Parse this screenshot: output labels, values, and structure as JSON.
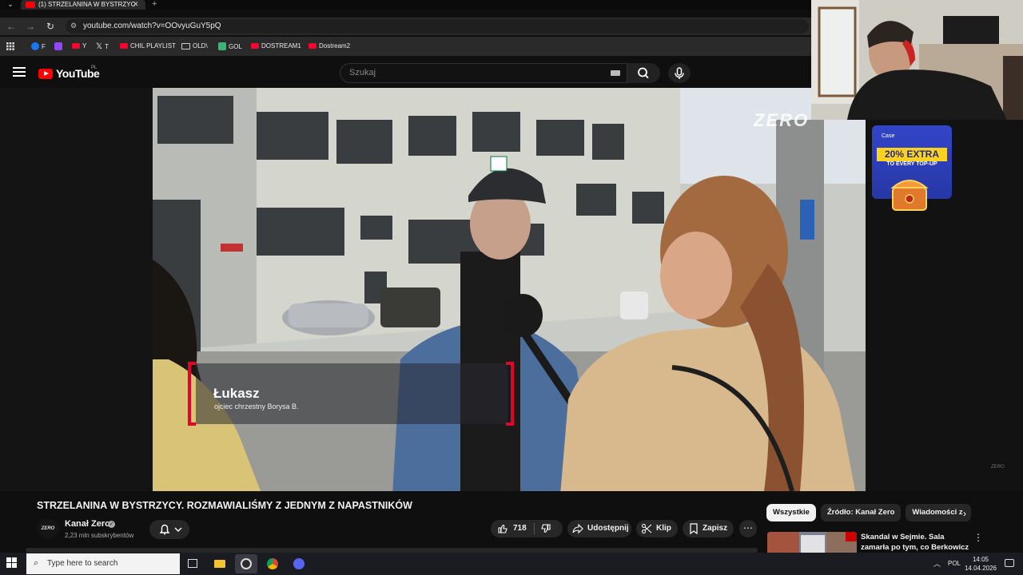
{
  "browser": {
    "tab_title": "(1) STRZELANINA W BYSTRZYC",
    "tab_close": "✕",
    "new_tab": "+",
    "url": "youtube.com/watch?v=OOvyuGuY5pQ",
    "bookmarks": [
      {
        "label": "F",
        "icon": "facebook-icon",
        "color": "#1877f2"
      },
      {
        "label": "",
        "icon": "twitch-icon",
        "color": "#9146ff"
      },
      {
        "label": "Y",
        "icon": "youtube-icon",
        "color": "#ff0033"
      },
      {
        "label": "T",
        "icon": "x-icon",
        "color": "#e7e7e7"
      },
      {
        "label": "CHIL PLAYLIST",
        "icon": "youtube-icon",
        "color": "#ff0033"
      },
      {
        "label": "OLD\\",
        "icon": "folder-icon",
        "color": "#c8c8c8"
      },
      {
        "label": "GOL",
        "icon": "gol-icon",
        "color": "#3bb37a"
      },
      {
        "label": "DOSTREAM1",
        "icon": "youtube-icon",
        "color": "#ff0033"
      },
      {
        "label": "Dostream2",
        "icon": "youtube-icon",
        "color": "#ff0033"
      }
    ]
  },
  "youtube": {
    "logo_text": "YouTube",
    "region": "PL",
    "search_placeholder": "Szukaj",
    "accent": "#ff0000"
  },
  "video": {
    "lower_third_name": "Łukasz",
    "lower_third_role": "ojciec chrzestny Borysa B.",
    "watermark": "ZERO",
    "watermark_small": "ZERO",
    "accent": "#e3002b"
  },
  "ad": {
    "brand": "Case",
    "headline": "20% EXTRA",
    "sub": "TO EVERY TOP-UP"
  },
  "below": {
    "title": "STRZELANINA W BYSTRZYCY. ROZMAWIALIŚMY Z JEDNYM Z NAPASTNIKÓW",
    "channel_avatar": "ZERO",
    "channel_name": "Kanał Zero",
    "subscribers": "2,23 mln subskrybentów",
    "likes": "718",
    "share": "Udostępnij",
    "clip": "Klip",
    "save": "Zapisz",
    "chips": [
      "Wszystkie",
      "Źródło: Kanał Zero",
      "Wiadomości z"
    ],
    "rec_title": "Skandal w Sejmie. Sala zamarła po tym, co Berkowicz wyjął na ..."
  },
  "taskbar": {
    "search_placeholder": "Type here to search",
    "lang": "POL",
    "time": "14:05",
    "date": "14.04.2026"
  }
}
